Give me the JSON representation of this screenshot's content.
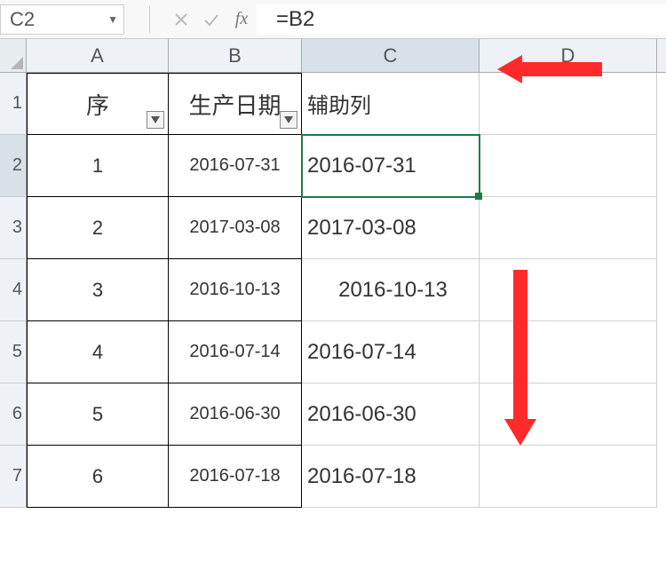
{
  "name_box": {
    "ref": "C2"
  },
  "formula_bar": {
    "cancel_title": "Cancel",
    "confirm_title": "Enter",
    "fx_label": "fx",
    "value": "=B2"
  },
  "columns": [
    {
      "label": "A",
      "selected": false
    },
    {
      "label": "B",
      "selected": false
    },
    {
      "label": "C",
      "selected": true
    },
    {
      "label": "D",
      "selected": false
    }
  ],
  "row_headers": [
    "1",
    "2",
    "3",
    "4",
    "5",
    "6",
    "7"
  ],
  "selected_row_header_index": 1,
  "headers": {
    "A": "序",
    "B": "生产日期",
    "C": "辅助列"
  },
  "rows": [
    {
      "A": "1",
      "B": "2016-07-31",
      "C": "2016-07-31"
    },
    {
      "A": "2",
      "B": "2017-03-08",
      "C": "2017-03-08"
    },
    {
      "A": "3",
      "B": "2016-10-13",
      "C": "2016-10-13"
    },
    {
      "A": "4",
      "B": "2016-07-14",
      "C": "2016-07-14"
    },
    {
      "A": "5",
      "B": "2016-06-30",
      "C": "2016-06-30"
    },
    {
      "A": "6",
      "B": "2016-07-18",
      "C": "2016-07-18"
    }
  ],
  "selection": {
    "cell": "C2"
  },
  "colors": {
    "accent": "#1a7a45",
    "arrow": "#ff2a2a"
  }
}
